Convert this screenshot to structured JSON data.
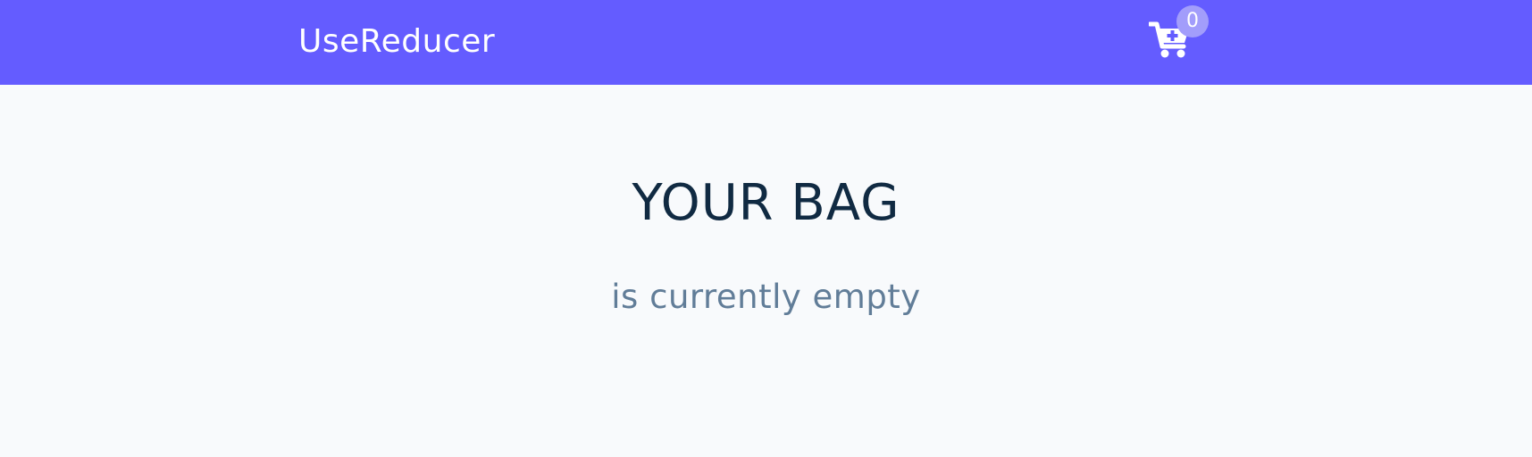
{
  "navbar": {
    "brand": "UseReducer",
    "cart_icon": "cart-plus-icon",
    "cart_count": "0",
    "background_color": "#645cff",
    "badge_color": "#a29dfb"
  },
  "main": {
    "title": "YOUR BAG",
    "empty_message": "is currently empty",
    "title_color": "#102a42",
    "message_color": "#617d98",
    "background_color": "#f8fafc"
  }
}
